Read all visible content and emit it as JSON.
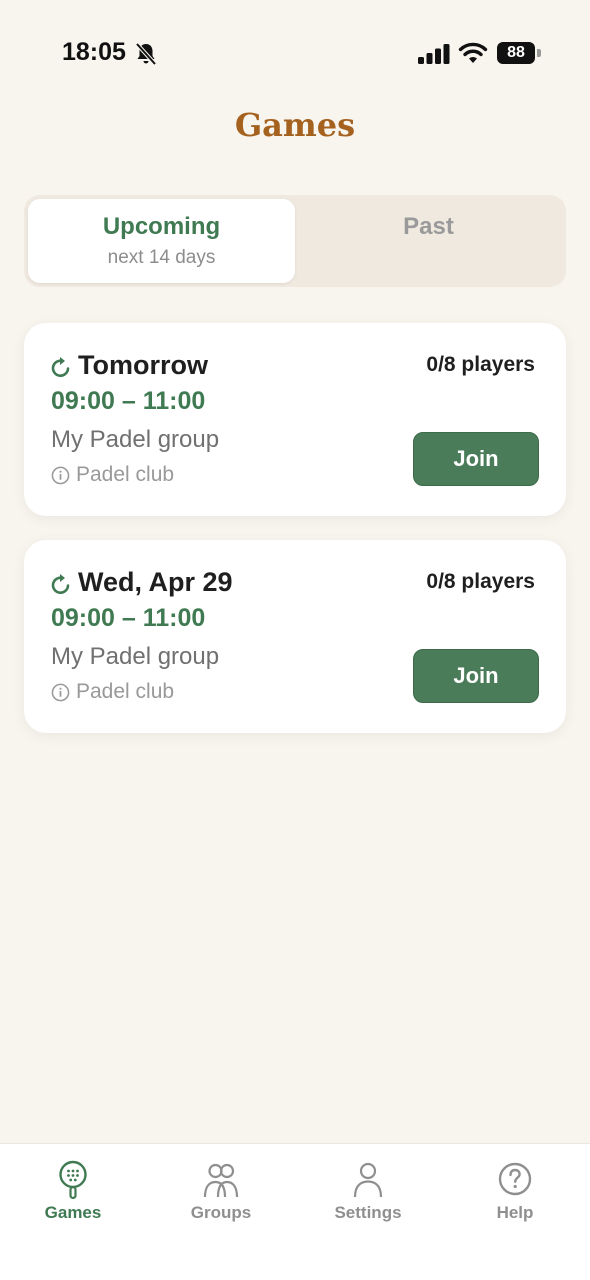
{
  "status_bar": {
    "time": "18:05",
    "battery": "88",
    "icons": [
      "bell-slash-icon",
      "cellular-signal-icon",
      "wifi-icon",
      "battery-icon"
    ]
  },
  "header": {
    "title": "Games"
  },
  "segmented": {
    "upcoming_label": "Upcoming",
    "upcoming_sub": "next 14 days",
    "past_label": "Past",
    "selected": "Upcoming"
  },
  "games": [
    {
      "date": "Tomorrow",
      "time": "09:00 – 11:00",
      "group": "My Padel group",
      "club": "Padel club",
      "players": "0/8 players",
      "join_label": "Join"
    },
    {
      "date": "Wed, Apr 29",
      "time": "09:00 – 11:00",
      "group": "My Padel group",
      "club": "Padel club",
      "players": "0/8 players",
      "join_label": "Join"
    }
  ],
  "tab_bar": {
    "items": [
      {
        "label": "Games",
        "icon": "padel-racket-icon",
        "active": true
      },
      {
        "label": "Groups",
        "icon": "people-icon",
        "active": false
      },
      {
        "label": "Settings",
        "icon": "person-icon",
        "active": false
      },
      {
        "label": "Help",
        "icon": "question-circle-icon",
        "active": false
      }
    ]
  },
  "colors": {
    "background": "#f8f4ee",
    "title": "#a5621f",
    "accent_green": "#3f7a52",
    "join_button": "#4a7c59",
    "inactive": "#8f8f8f"
  }
}
